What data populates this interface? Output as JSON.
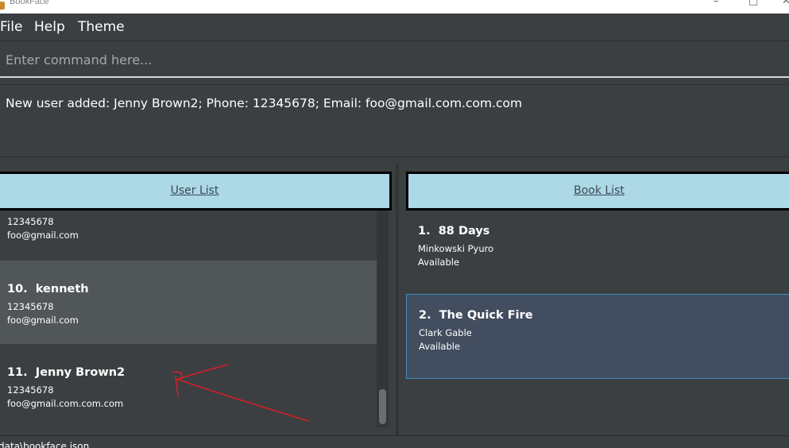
{
  "window": {
    "title": "BookFace"
  },
  "menu": {
    "file": "File",
    "help": "Help",
    "theme": "Theme"
  },
  "command": {
    "placeholder": "Enter command here...",
    "value": ""
  },
  "result": {
    "text": "New user added: Jenny Brown2; Phone: 12345678; Email: foo@gmail.com.com.com"
  },
  "user_list": {
    "header": "User List",
    "items": [
      {
        "index": "",
        "name": "",
        "phone": "12345678",
        "email": "foo@gmail.com"
      },
      {
        "index": "10.",
        "name": "kenneth",
        "phone": "12345678",
        "email": "foo@gmail.com"
      },
      {
        "index": "11.",
        "name": "Jenny Brown2",
        "phone": "12345678",
        "email": "foo@gmail.com.com.com"
      }
    ]
  },
  "book_list": {
    "header": "Book List",
    "items": [
      {
        "index": "1.",
        "title": "88 Days",
        "author": "Minkowski Pyuro",
        "status": "Available"
      },
      {
        "index": "2.",
        "title": "The Quick Fire",
        "author": "Clark Gable",
        "status": "Available"
      }
    ]
  },
  "status": {
    "path": "data\\bookface.json"
  },
  "colors": {
    "header_bg": "#add8e6",
    "selected_user": "#515658",
    "selected_book": "#424d5f",
    "annotation": "#d21f26"
  }
}
